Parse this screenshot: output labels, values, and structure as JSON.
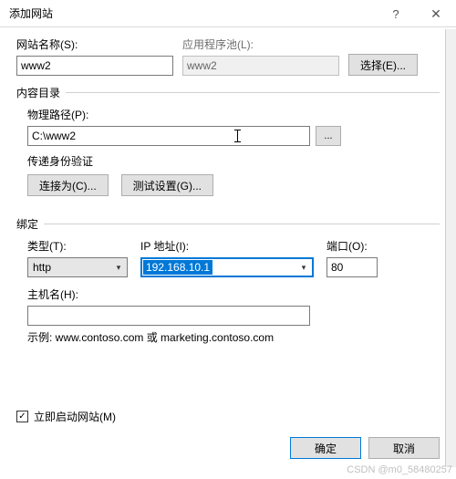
{
  "titlebar": {
    "title": "添加网站"
  },
  "siteName": {
    "label": "网站名称(S):",
    "value": "www2"
  },
  "appPool": {
    "label": "应用程序池(L):",
    "value": "www2",
    "selectBtn": "选择(E)..."
  },
  "contentDir": {
    "header": "内容目录",
    "pathLabel": "物理路径(P):",
    "pathValue": "C:\\www2",
    "browse": "...",
    "authLabel": "传递身份验证",
    "connectAs": "连接为(C)...",
    "testSettings": "测试设置(G)..."
  },
  "binding": {
    "header": "绑定",
    "typeLabel": "类型(T):",
    "typeValue": "http",
    "ipLabel": "IP 地址(I):",
    "ipValue": "192.168.10.1",
    "portLabel": "端口(O):",
    "portValue": "80",
    "hostLabel": "主机名(H):",
    "hostValue": "",
    "example": "示例: www.contoso.com 或 marketing.contoso.com"
  },
  "startNow": {
    "checked": true,
    "label": "立即启动网站(M)"
  },
  "footer": {
    "ok": "确定",
    "cancel": "取消"
  },
  "watermark": "CSDN @m0_58480257"
}
